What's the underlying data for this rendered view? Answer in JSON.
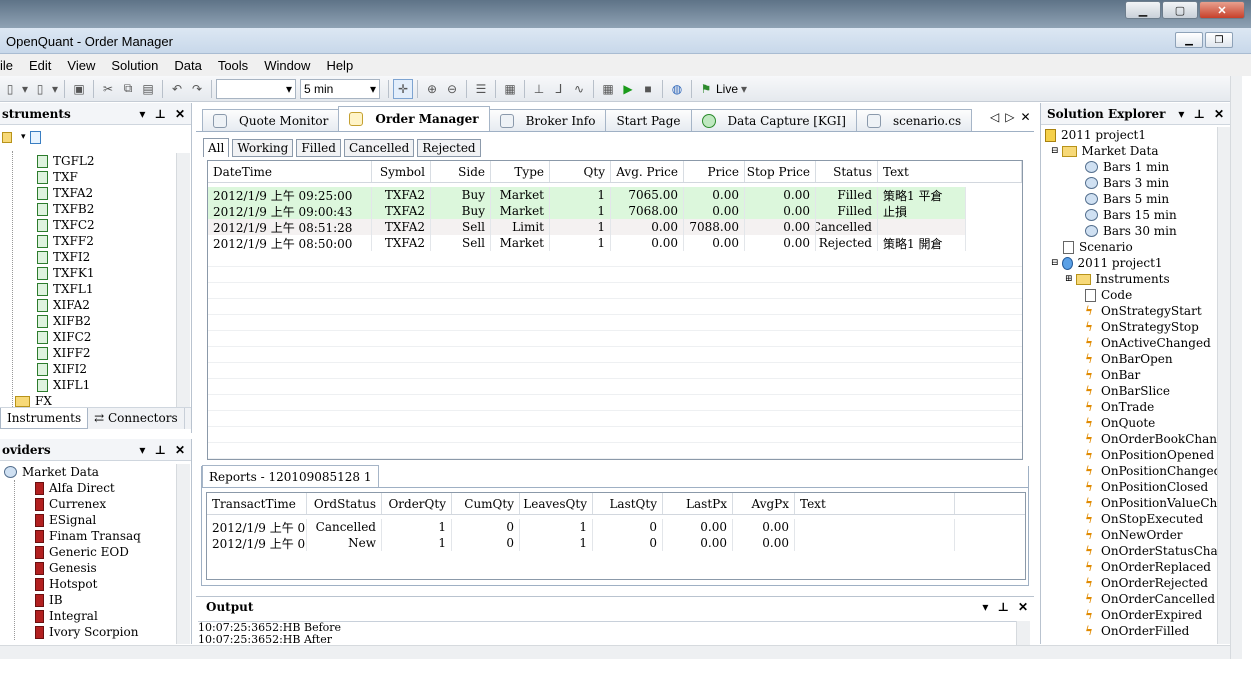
{
  "window": {
    "title": "OpenQuant - Order Manager"
  },
  "menu": [
    "ile",
    "Edit",
    "View",
    "Solution",
    "Data",
    "Tools",
    "Window",
    "Help"
  ],
  "toolbar": {
    "combo1": "",
    "combo2": "5 min",
    "live": "Live"
  },
  "instruments": {
    "title": "struments",
    "items": [
      "TGFL2",
      "TXF",
      "TXFA2",
      "TXFB2",
      "TXFC2",
      "TXFF2",
      "TXFI2",
      "TXFK1",
      "TXFL1",
      "XIFA2",
      "XIFB2",
      "XIFC2",
      "XIFF2",
      "XIFI2",
      "XIFL1"
    ],
    "fx": "FX",
    "tabs": [
      "Instruments",
      "Connectors"
    ]
  },
  "providers": {
    "title": "oviders",
    "group": "Market Data",
    "items": [
      "Alfa Direct",
      "Currenex",
      "ESignal",
      "Finam Transaq",
      "Generic EOD",
      "Genesis",
      "Hotspot",
      "IB",
      "Integral",
      "Ivory Scorpion"
    ]
  },
  "doctabs": [
    "Quote Monitor",
    "Order Manager",
    "Broker Info",
    "Start Page",
    "Data Capture [KGI]",
    "scenario.cs"
  ],
  "filters": [
    "All",
    "Working",
    "Filled",
    "Cancelled",
    "Rejected"
  ],
  "orders": {
    "headers": [
      "DateTime",
      "Symbol",
      "Side",
      "Type",
      "Qty",
      "Avg. Price",
      "Price",
      "Stop Price",
      "Status",
      "Text"
    ],
    "rows": [
      [
        "2012/1/9 上午 09:25:00",
        "TXFA2",
        "Buy",
        "Market",
        "1",
        "7065.00",
        "0.00",
        "0.00",
        "Filled",
        "策略1 平倉"
      ],
      [
        "2012/1/9 上午 09:00:43",
        "TXFA2",
        "Buy",
        "Market",
        "1",
        "7068.00",
        "0.00",
        "0.00",
        "Filled",
        "止損"
      ],
      [
        "2012/1/9 上午 08:51:28",
        "TXFA2",
        "Sell",
        "Limit",
        "1",
        "0.00",
        "7088.00",
        "0.00",
        "Cancelled",
        ""
      ],
      [
        "2012/1/9 上午 08:50:00",
        "TXFA2",
        "Sell",
        "Market",
        "1",
        "0.00",
        "0.00",
        "0.00",
        "Rejected",
        "策略1 開倉"
      ]
    ]
  },
  "reports": {
    "tab": "Reports - 120109085128 1",
    "headers": [
      "TransactTime",
      "OrdStatus",
      "OrderQty",
      "CumQty",
      "LeavesQty",
      "LastQty",
      "LastPx",
      "AvgPx",
      "Text"
    ],
    "rows": [
      [
        "2012/1/9 上午 0...",
        "Cancelled",
        "1",
        "0",
        "1",
        "0",
        "0.00",
        "0.00",
        ""
      ],
      [
        "2012/1/9 上午 0...",
        "New",
        "1",
        "0",
        "1",
        "0",
        "0.00",
        "0.00",
        ""
      ]
    ]
  },
  "output": {
    "title": "Output",
    "lines": [
      "10:07:25:3652:HB Before",
      "10:07:25:3652:HB After"
    ]
  },
  "solution": {
    "title": "Solution Explorer",
    "root": "2011 project1",
    "marketData": "Market Data",
    "bars": [
      "Bars 1 min",
      "Bars 3 min",
      "Bars 5 min",
      "Bars 15 min",
      "Bars 30 min"
    ],
    "scenario": "Scenario",
    "project": "2011 project1",
    "instruments": "Instruments",
    "code": "Code",
    "events": [
      "OnStrategyStart",
      "OnStrategyStop",
      "OnActiveChanged",
      "OnBarOpen",
      "OnBar",
      "OnBarSlice",
      "OnTrade",
      "OnQuote",
      "OnOrderBookChanged",
      "OnPositionOpened",
      "OnPositionChanged",
      "OnPositionClosed",
      "OnPositionValueChange",
      "OnStopExecuted",
      "OnNewOrder",
      "OnOrderStatusChanged",
      "OnOrderReplaced",
      "OnOrderRejected",
      "OnOrderCancelled",
      "OnOrderExpired",
      "OnOrderFilled"
    ]
  },
  "colors": {
    "filledRow": "#dcf7dc",
    "titleBar": "#c8d8ea"
  }
}
